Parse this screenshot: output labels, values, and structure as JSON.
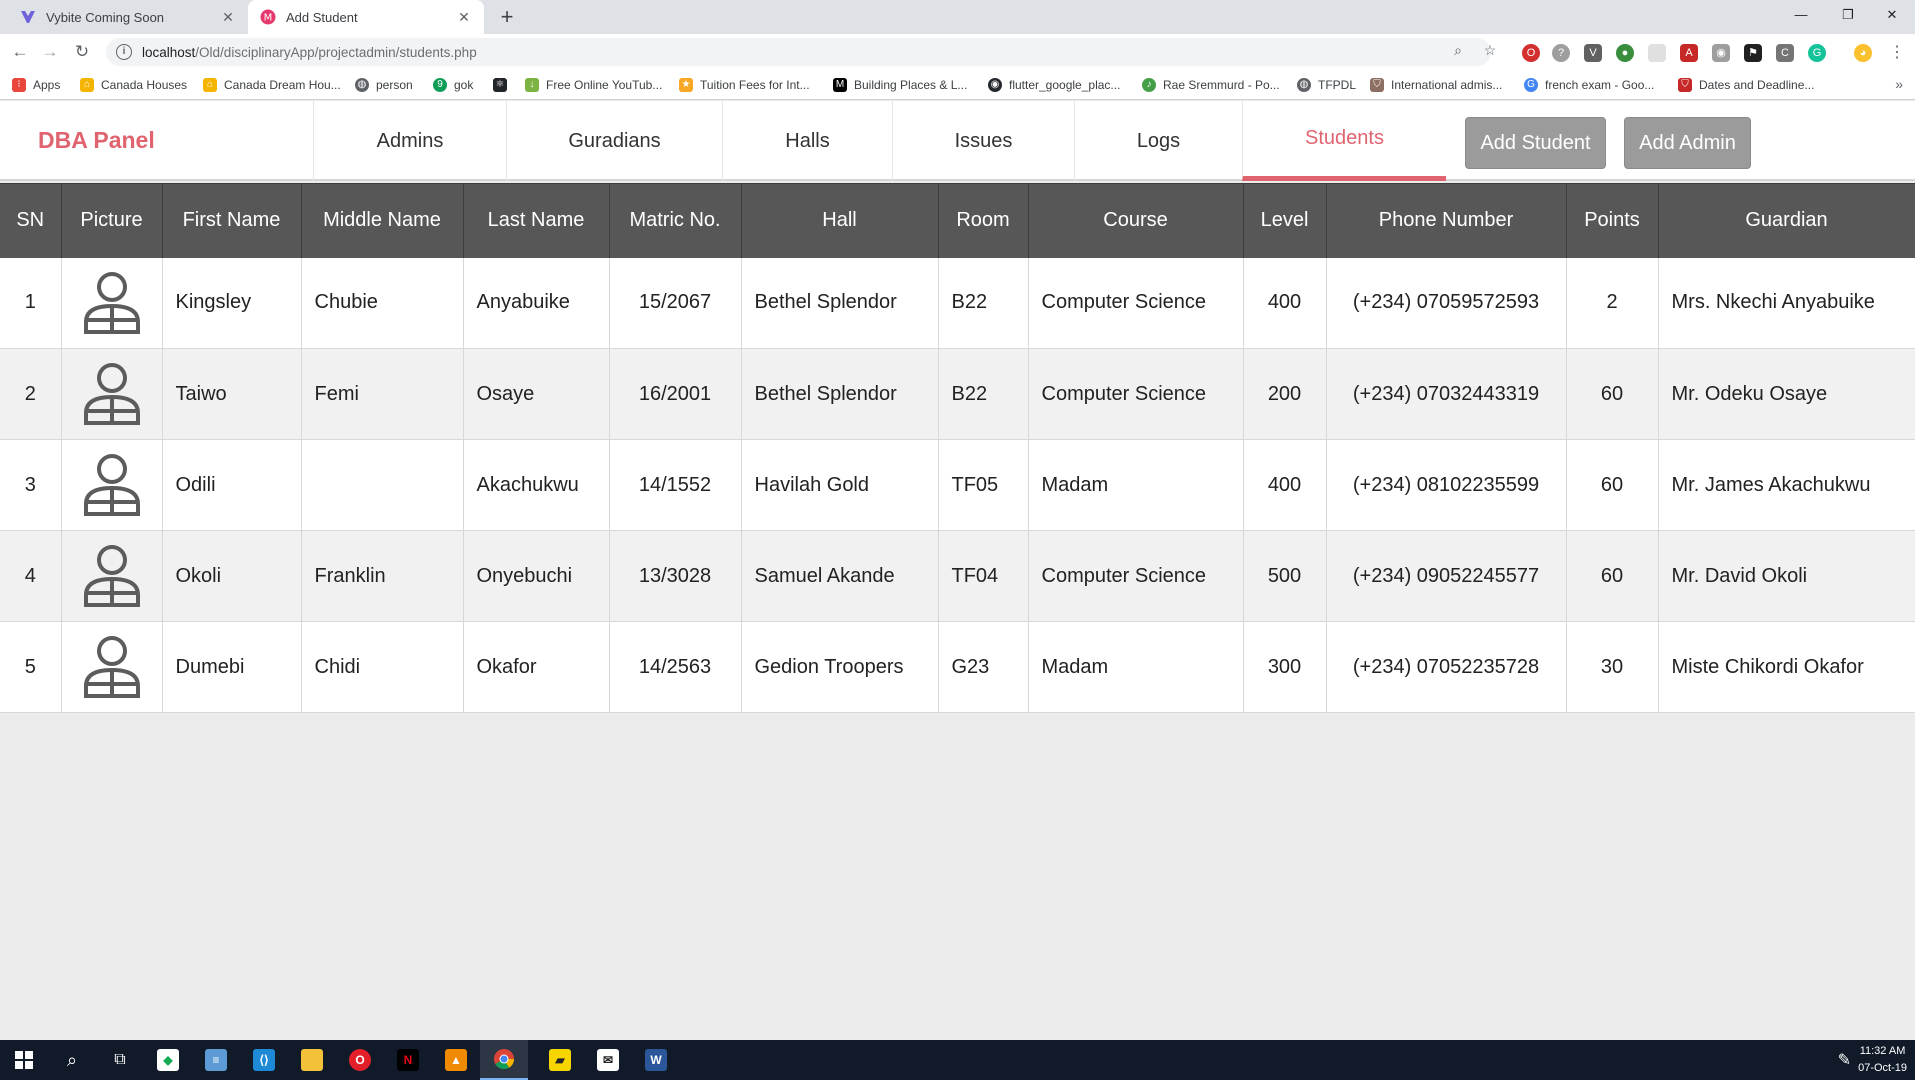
{
  "browser": {
    "tabs": [
      {
        "title": "Vybite Coming Soon",
        "active": false,
        "icon": "vybite-icon"
      },
      {
        "title": "Add Student",
        "active": true,
        "icon": "favicon-icon"
      }
    ],
    "url_host": "localhost",
    "url_path": "/Old/disciplinaryApp/projectadmin/students.php",
    "bookmarks": [
      {
        "label": "Apps",
        "icon": "apps-grid-icon",
        "color": "#e8453c"
      },
      {
        "label": "Canada Houses",
        "icon": "house-icon",
        "color": "#f4b400"
      },
      {
        "label": "Canada Dream Hou...",
        "icon": "house-icon",
        "color": "#f4b400"
      },
      {
        "label": "person",
        "icon": "globe-icon",
        "color": "#5f6368"
      },
      {
        "label": "gok",
        "icon": "g-icon",
        "color": "#0f9d58"
      },
      {
        "label": "",
        "icon": "react-icon",
        "color": "#20232a"
      },
      {
        "label": "Free Online YouTub...",
        "icon": "download-icon",
        "color": "#7cb342"
      },
      {
        "label": "Tuition Fees for Int...",
        "icon": "star-icon",
        "color": "#f9a825"
      },
      {
        "label": "Building Places & L...",
        "icon": "medium-icon",
        "color": "#000000"
      },
      {
        "label": "flutter_google_plac...",
        "icon": "github-icon",
        "color": "#24292e"
      },
      {
        "label": "Rae Sremmurd - Po...",
        "icon": "music-icon",
        "color": "#43a047"
      },
      {
        "label": "TFPDL",
        "icon": "globe-icon",
        "color": "#5f6368"
      },
      {
        "label": "International admis...",
        "icon": "crest-icon",
        "color": "#8d6e63"
      },
      {
        "label": "french exam - Goo...",
        "icon": "google-icon",
        "color": "#4285f4"
      },
      {
        "label": "Dates and Deadline...",
        "icon": "crest-icon",
        "color": "#c62828"
      }
    ]
  },
  "app": {
    "brand": "DBA Panel",
    "nav": [
      "Admins",
      "Guradians",
      "Halls",
      "Issues",
      "Logs",
      "Students"
    ],
    "active_nav": "Students",
    "buttons": {
      "add_student": "Add Student",
      "add_admin": "Add Admin"
    },
    "accent": "#e06470"
  },
  "table": {
    "headers": [
      "SN",
      "Picture",
      "First Name",
      "Middle Name",
      "Last Name",
      "Matric No.",
      "Hall",
      "Room",
      "Course",
      "Level",
      "Phone Number",
      "Points",
      "Guardian"
    ],
    "rows": [
      {
        "sn": "1",
        "first": "Kingsley",
        "middle": "Chubie",
        "last": "Anyabuike",
        "matric": "15/2067",
        "hall": "Bethel Splendor",
        "room": "B22",
        "course": "Computer Science",
        "level": "400",
        "phone": "(+234) 07059572593",
        "points": "2",
        "guardian": "Mrs. Nkechi Anyabuike"
      },
      {
        "sn": "2",
        "first": "Taiwo",
        "middle": "Femi",
        "last": "Osaye",
        "matric": "16/2001",
        "hall": "Bethel Splendor",
        "room": "B22",
        "course": "Computer Science",
        "level": "200",
        "phone": "(+234) 07032443319",
        "points": "60",
        "guardian": "Mr. Odeku Osaye"
      },
      {
        "sn": "3",
        "first": "Odili",
        "middle": "",
        "last": "Akachukwu",
        "matric": "14/1552",
        "hall": "Havilah Gold",
        "room": "TF05",
        "course": "Madam",
        "level": "400",
        "phone": "(+234) 08102235599",
        "points": "60",
        "guardian": "Mr. James Akachukwu"
      },
      {
        "sn": "4",
        "first": "Okoli",
        "middle": "Franklin",
        "last": "Onyebuchi",
        "matric": "13/3028",
        "hall": "Samuel Akande",
        "room": "TF04",
        "course": "Computer Science",
        "level": "500",
        "phone": "(+234) 09052245577",
        "points": "60",
        "guardian": "Mr. David Okoli"
      },
      {
        "sn": "5",
        "first": "Dumebi",
        "middle": "Chidi",
        "last": "Okafor",
        "matric": "14/2563",
        "hall": "Gedion Troopers",
        "room": "G23",
        "course": "Madam",
        "level": "300",
        "phone": "(+234) 07052235728",
        "points": "30",
        "guardian": "Miste Chikordi Okafor"
      }
    ]
  },
  "taskbar": {
    "time": "11:32 AM",
    "date": "07-Oct-19"
  }
}
